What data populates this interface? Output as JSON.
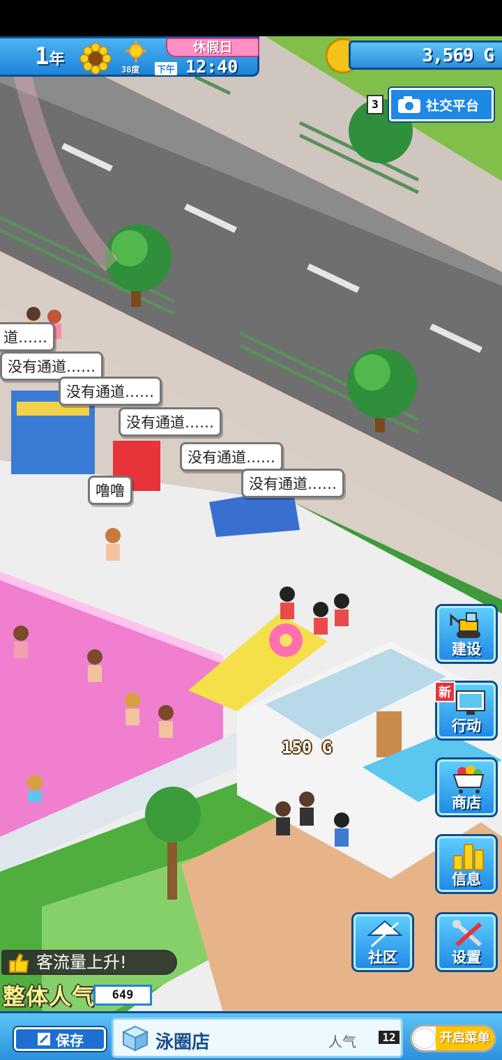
{
  "hud": {
    "year_num": "1",
    "year_unit": "年",
    "holiday": "休假日",
    "temperature": "38度",
    "ampm": "下午",
    "time": "12:40",
    "money": "3,569 G"
  },
  "social": {
    "count": "3",
    "label": "社交平台"
  },
  "bubbles": {
    "b1": "道……",
    "b2": "没有通道……",
    "b3": "没有通道……",
    "b4": "没有通道……",
    "b5": "没有通道……",
    "b6": "没有通道……",
    "b7": "噜噜"
  },
  "floating_money": "150 G",
  "side_menu": {
    "build": "建设",
    "action": "行动",
    "action_badge": "新",
    "shop": "商店",
    "info": "信息",
    "community": "社区",
    "settings": "设置"
  },
  "notice": "客流量上升!",
  "popularity": {
    "label": "整体人气",
    "value": "649"
  },
  "bottom": {
    "save": "保存",
    "store_name": "泳圈店",
    "pop_label": "人气",
    "pop_value": "12",
    "menu_toggle": "开启菜单"
  }
}
